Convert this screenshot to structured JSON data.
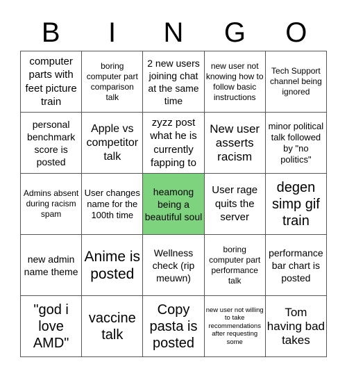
{
  "header": {
    "letters": [
      "B",
      "I",
      "N",
      "G",
      "O"
    ]
  },
  "colors": {
    "free_space": "#7ed37e",
    "grid_line": "#555555"
  },
  "board": {
    "rows": [
      [
        "computer parts with feet picture train",
        "boring computer part comparison talk",
        "2 new users joining chat at the same time",
        "new user not knowing how to follow basic instructions",
        "Tech Support channel being ignored"
      ],
      [
        "personal benchmark score is posted",
        "Apple vs competitor talk",
        "zyzz post what he is currently fapping to",
        "New user asserts racism",
        "minor political talk followed by \"no politics\""
      ],
      [
        "Admins absent during racism spam",
        "User changes name for the 100th time",
        "heamong being a beautiful soul",
        "User rage quits the server",
        "degen simp gif train"
      ],
      [
        "new admin name theme",
        "Anime is posted",
        "Wellness check (rip meuwn)",
        "boring computer part performance talk",
        "performance bar chart is posted"
      ],
      [
        "\"god i love AMD\"",
        "vaccine talk",
        "Copy pasta is posted",
        "new user not willing to take recommendations after requesting some",
        "Tom having bad takes"
      ]
    ],
    "marked": [
      [
        2,
        2
      ]
    ]
  }
}
